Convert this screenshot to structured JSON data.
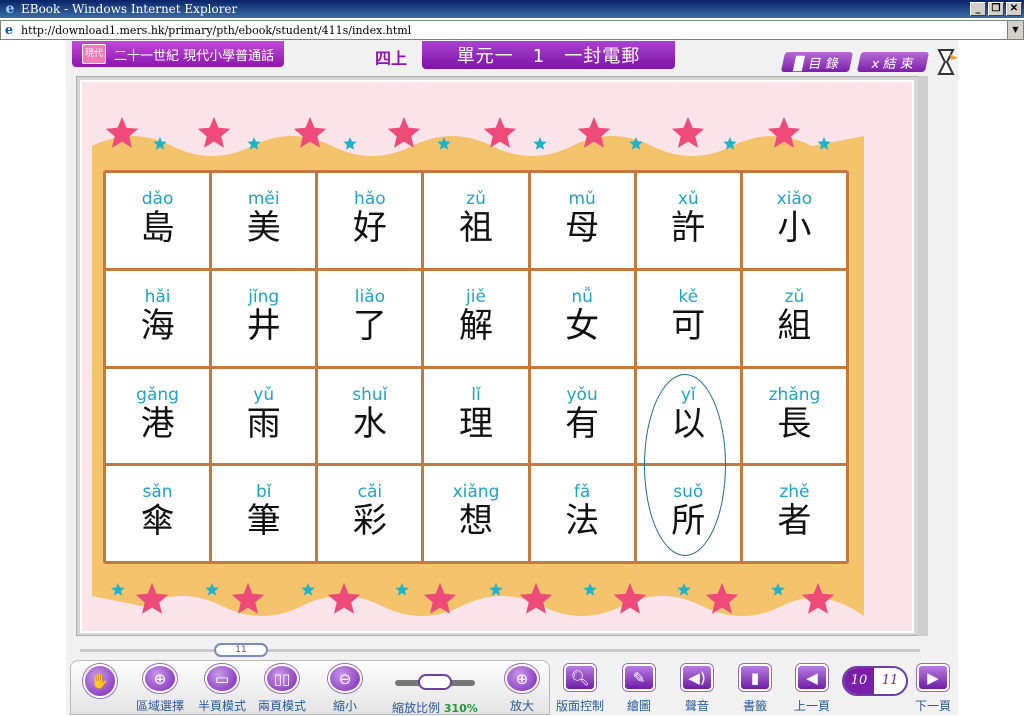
{
  "window": {
    "title": "EBook - Windows Internet Explorer",
    "url": "http://download1.mers.hk/primary/pth/ebook/student/411s/index.html",
    "btn_min": "_",
    "btn_max": "❐",
    "btn_close": "✕"
  },
  "header": {
    "series": "二十一世紀 現代小學普通話",
    "series_icon_text": "現代",
    "grade": "四上",
    "unit": "單元一　1　一封電郵",
    "toc_label": "▉ 目 錄",
    "end_label": "x 結 束"
  },
  "cards": [
    [
      {
        "py": "dǎo",
        "hz": "島"
      },
      {
        "py": "měi",
        "hz": "美"
      },
      {
        "py": "hǎo",
        "hz": "好"
      },
      {
        "py": "zǔ",
        "hz": "祖"
      },
      {
        "py": "mǔ",
        "hz": "母"
      },
      {
        "py": "xǔ",
        "hz": "許"
      },
      {
        "py": "xiǎo",
        "hz": "小"
      }
    ],
    [
      {
        "py": "hǎi",
        "hz": "海"
      },
      {
        "py": "jǐng",
        "hz": "井"
      },
      {
        "py": "liǎo",
        "hz": "了"
      },
      {
        "py": "jiě",
        "hz": "解"
      },
      {
        "py": "nǚ",
        "hz": "女"
      },
      {
        "py": "kě",
        "hz": "可"
      },
      {
        "py": "zǔ",
        "hz": "組"
      }
    ],
    [
      {
        "py": "gǎng",
        "hz": "港"
      },
      {
        "py": "yǔ",
        "hz": "雨"
      },
      {
        "py": "shuǐ",
        "hz": "水"
      },
      {
        "py": "lǐ",
        "hz": "理"
      },
      {
        "py": "yǒu",
        "hz": "有"
      },
      {
        "py": "yǐ",
        "hz": "以"
      },
      {
        "py": "zhǎng",
        "hz": "長"
      }
    ],
    [
      {
        "py": "sǎn",
        "hz": "傘"
      },
      {
        "py": "bǐ",
        "hz": "筆"
      },
      {
        "py": "cǎi",
        "hz": "彩"
      },
      {
        "py": "xiǎng",
        "hz": "想"
      },
      {
        "py": "fǎ",
        "hz": "法"
      },
      {
        "py": "suǒ",
        "hz": "所"
      },
      {
        "py": "zhě",
        "hz": "者"
      }
    ]
  ],
  "scroll": {
    "page_badge": "11"
  },
  "toolbar": {
    "hand_icon": "✋",
    "area_select": "區域選擇",
    "half_page": "半頁模式",
    "two_page": "兩頁模式",
    "zoom_out": "縮小",
    "zoom_ratio": "縮放比例",
    "zoom_pct": "310%",
    "zoom_in": "放大",
    "layout_ctrl": "版面控制",
    "draw": "繪圖",
    "sound": "聲音",
    "bookmark": "書籤",
    "prev_page": "上一頁",
    "page_left": "10",
    "page_right": "11",
    "next_page": "下一頁"
  },
  "colors": {
    "accent": "#7b1fa8",
    "pinyin": "#1fa3c7",
    "card_border": "#c47a3e",
    "page_bg": "#fbe3ea",
    "banner": "#f6c36d"
  }
}
